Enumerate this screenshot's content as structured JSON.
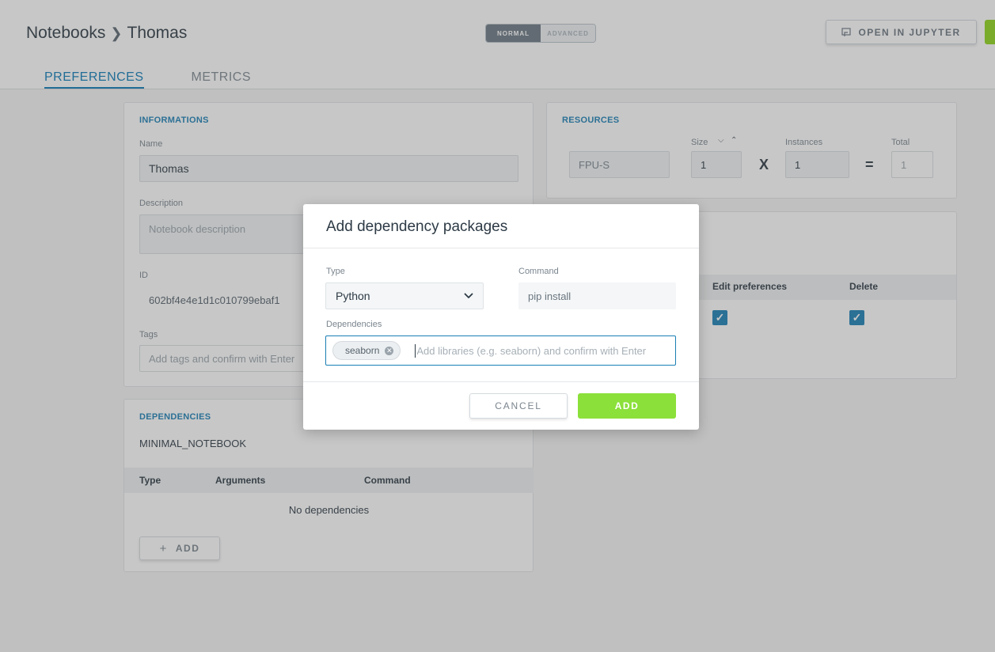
{
  "header": {
    "breadcrumb": {
      "root": "Notebooks",
      "current": "Thomas"
    },
    "mode_toggle": {
      "normal": "NORMAL",
      "advanced": "ADVANCED"
    },
    "open_jupyter_label": "OPEN IN JUPYTER",
    "icons": {
      "jupyter": "external-window-icon",
      "separator": "chevron-right-icon"
    }
  },
  "tabs": [
    {
      "label": "PREFERENCES",
      "active": true
    },
    {
      "label": "METRICS",
      "active": false
    }
  ],
  "informations": {
    "title": "INFORMATIONS",
    "name_label": "Name",
    "name_value": "Thomas",
    "description_label": "Description",
    "description_placeholder": "Notebook description",
    "id_label": "ID",
    "id_value": "602bf4e4e1d1c010799ebaf1",
    "tags_label": "Tags",
    "tags_placeholder": "Add tags and confirm with Enter"
  },
  "resources": {
    "title": "RESOURCES",
    "type_value": "FPU-S",
    "size_label": "Size",
    "size_value": "1",
    "multiply": "X",
    "instances_label": "Instances",
    "instances_value": "1",
    "equals": "=",
    "total_label": "Total",
    "total_value": "1"
  },
  "permissions": {
    "col_edit": "Edit preferences",
    "col_delete": "Delete",
    "edit_checked": true,
    "delete_checked": true
  },
  "dependencies": {
    "title": "DEPENDENCIES",
    "base_image": "MINIMAL_NOTEBOOK",
    "col_type": "Type",
    "col_arguments": "Arguments",
    "col_command": "Command",
    "empty_text": "No dependencies",
    "add_label": "ADD",
    "add_icon": "plus-icon"
  },
  "modal": {
    "title": "Add dependency packages",
    "type_label": "Type",
    "type_value": "Python",
    "command_label": "Command",
    "command_value": "pip install",
    "dependencies_label": "Dependencies",
    "chips": [
      "seaborn"
    ],
    "dependencies_placeholder": "Add libraries (e.g. seaborn) and confirm with Enter",
    "cancel_label": "CANCEL",
    "add_label": "ADD"
  },
  "colors": {
    "accent": "#1a7fb5",
    "add_button": "#8be03a",
    "overlay": "rgba(80,80,80,0.32)"
  }
}
